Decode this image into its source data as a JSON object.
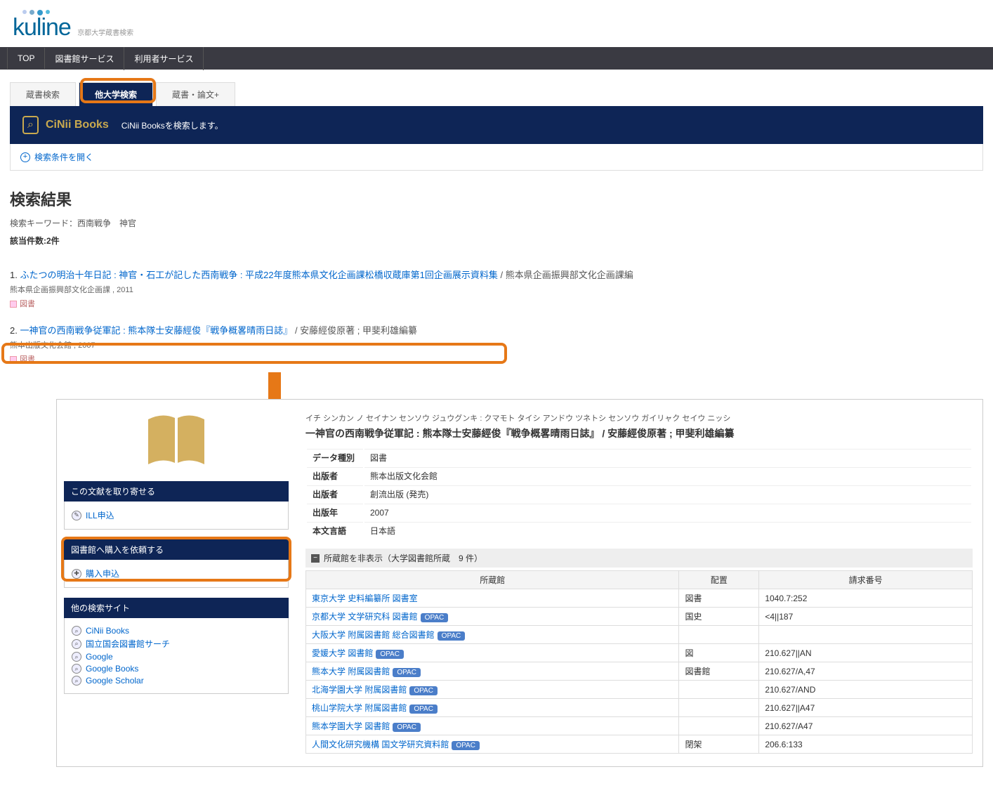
{
  "logo": {
    "text": "kuline",
    "subtitle": "京都大学蔵書検索"
  },
  "topnav": {
    "items": [
      "TOP",
      "図書館サービス",
      "利用者サービス"
    ]
  },
  "search_tabs": {
    "local": "蔵書検索",
    "other_univ": "他大学検索",
    "articles": "蔵書・論文+"
  },
  "cinii": {
    "icon": "⌕",
    "title": "CiNii Books",
    "desc": "CiNii Booksを検索します。"
  },
  "expand": "検索条件を開く",
  "results": {
    "heading": "検索結果",
    "keyword_label": "検索キーワード：西南戦争　神官",
    "count_label": "該当件数:2件",
    "items": [
      {
        "num": "1. ",
        "title": "ふたつの明治十年日記 : 神官・石工が記した西南戦争 : 平成22年度熊本県文化企画課松橋収蔵庫第1回企画展示資料集",
        "author": " / 熊本県企画振興部文化企画課編",
        "publisher": "熊本県企画振興部文化企画課 , 2011",
        "type": "図書"
      },
      {
        "num": "2. ",
        "title": "一神官の西南戦争従軍記 : 熊本隊士安藤經俊『戦争概畧晴雨日誌』",
        "author": " / 安藤經俊原著 ; 甲斐利雄編纂",
        "publisher": "熊本出版文化会館 , 2007",
        "type": "図書"
      }
    ]
  },
  "detail": {
    "kana": "イチ シンカン ノ セイナン センソウ ジュウグンキ : クマモト タイシ アンドウ ツネトシ センソウ ガイリャク セイウ ニッシ",
    "title": "一神官の西南戦争従軍記 : 熊本隊士安藤經俊『戦争概畧晴雨日誌』 / 安藤經俊原著 ; 甲斐利雄編纂",
    "meta": {
      "datatype_k": "データ種別",
      "datatype_v": "図書",
      "pub1_k": "出版者",
      "pub1_v": "熊本出版文化会館",
      "pub2_k": "出版者",
      "pub2_v": "創流出版 (発売)",
      "year_k": "出版年",
      "year_v": "2007",
      "lang_k": "本文言語",
      "lang_v": "日本語"
    },
    "holdings_header": "所蔵館を非表示（大学図書館所蔵　9 件）",
    "holdings_cols": {
      "lib": "所蔵館",
      "loc": "配置",
      "call": "請求番号"
    },
    "holdings": [
      {
        "lib": "東京大学 史料編纂所 図書室",
        "opac": false,
        "loc": "図書",
        "call": "1040.7:252"
      },
      {
        "lib": "京都大学 文学研究科 図書館",
        "opac": true,
        "loc": "国史",
        "call": "<4||187"
      },
      {
        "lib": "大阪大学 附属図書館 総合図書館",
        "opac": true,
        "loc": "",
        "call": ""
      },
      {
        "lib": "愛媛大学 図書館",
        "opac": true,
        "loc": "図",
        "call": "210.627||AN"
      },
      {
        "lib": "熊本大学 附属図書館",
        "opac": true,
        "loc": "図書館",
        "call": "210.627/A,47"
      },
      {
        "lib": "北海学園大学 附属図書館",
        "opac": true,
        "loc": "",
        "call": "210.627/AND"
      },
      {
        "lib": "桃山学院大学 附属図書館",
        "opac": true,
        "loc": "",
        "call": "210.627||A47"
      },
      {
        "lib": "熊本学園大学 図書館",
        "opac": true,
        "loc": "",
        "call": "210.627/A47"
      },
      {
        "lib": "人間文化研究機構 国文学研究資料館",
        "opac": true,
        "loc": "閉架",
        "call": "206.6:133"
      }
    ],
    "opac_label": "OPAC",
    "side": {
      "request_h": "この文献を取り寄せる",
      "ill": "ILL申込",
      "purchase_h": "図書館へ購入を依頼する",
      "purchase": "購入申込",
      "other_h": "他の検索サイト",
      "links": [
        "CiNii Books",
        "国立国会図書館サーチ",
        "Google",
        "Google Books",
        "Google Scholar"
      ]
    }
  }
}
